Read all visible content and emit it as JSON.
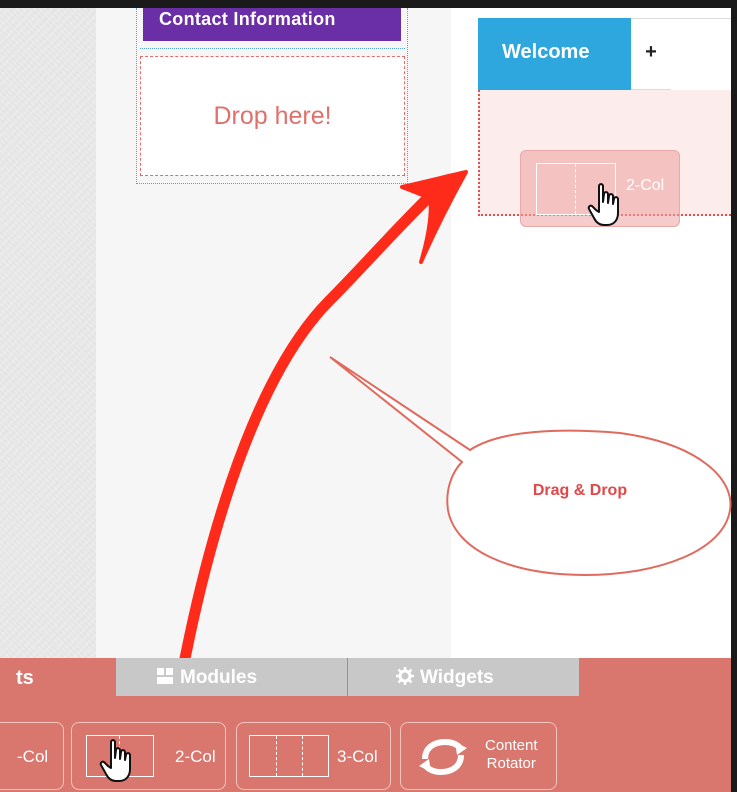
{
  "editor": {
    "contact_title": "Contact Information",
    "drop_hint": "Drop here!",
    "tabs": [
      {
        "label": "Welcome"
      },
      {
        "label": "+"
      }
    ],
    "dragged_item_label": "2-Col"
  },
  "annotation": {
    "callout_text": "Drag & Drop",
    "arrow_color": "#ff2b1a",
    "callout_border_color": "#e06a5e"
  },
  "bottom_panel": {
    "tabs": [
      {
        "label": "ts"
      },
      {
        "label": "Modules"
      },
      {
        "label": "Widgets"
      }
    ],
    "items": [
      {
        "label": "-Col"
      },
      {
        "label": "2-Col"
      },
      {
        "label": "3-Col"
      },
      {
        "label_line1": "Content",
        "label_line2": "Rotator"
      }
    ],
    "icons": {
      "modules_tab": "module-grid-icon",
      "widgets_tab": "widget-gear-icon",
      "rotator": "refresh-cycle-icon",
      "cursor": "hand-pointer-icon"
    }
  },
  "colors": {
    "accent_blue": "#2ea7de",
    "purple_header": "#6a2ea6",
    "panel_salmon": "#d9776f",
    "tab_gray": "#c8c8c8",
    "drop_text": "#e0706c"
  }
}
